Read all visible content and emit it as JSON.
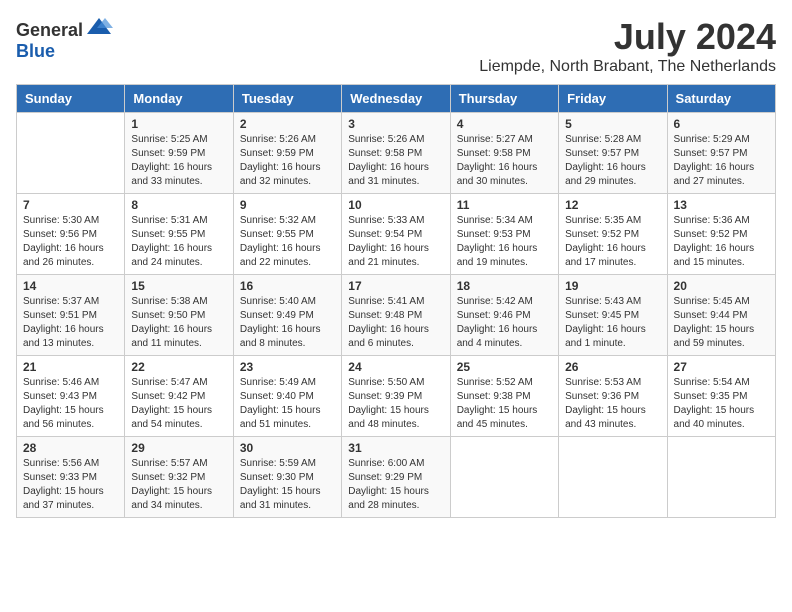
{
  "header": {
    "logo_general": "General",
    "logo_blue": "Blue",
    "month_year": "July 2024",
    "location": "Liempde, North Brabant, The Netherlands"
  },
  "days_of_week": [
    "Sunday",
    "Monday",
    "Tuesday",
    "Wednesday",
    "Thursday",
    "Friday",
    "Saturday"
  ],
  "weeks": [
    [
      {
        "day": "",
        "info": ""
      },
      {
        "day": "1",
        "info": "Sunrise: 5:25 AM\nSunset: 9:59 PM\nDaylight: 16 hours\nand 33 minutes."
      },
      {
        "day": "2",
        "info": "Sunrise: 5:26 AM\nSunset: 9:59 PM\nDaylight: 16 hours\nand 32 minutes."
      },
      {
        "day": "3",
        "info": "Sunrise: 5:26 AM\nSunset: 9:58 PM\nDaylight: 16 hours\nand 31 minutes."
      },
      {
        "day": "4",
        "info": "Sunrise: 5:27 AM\nSunset: 9:58 PM\nDaylight: 16 hours\nand 30 minutes."
      },
      {
        "day": "5",
        "info": "Sunrise: 5:28 AM\nSunset: 9:57 PM\nDaylight: 16 hours\nand 29 minutes."
      },
      {
        "day": "6",
        "info": "Sunrise: 5:29 AM\nSunset: 9:57 PM\nDaylight: 16 hours\nand 27 minutes."
      }
    ],
    [
      {
        "day": "7",
        "info": "Sunrise: 5:30 AM\nSunset: 9:56 PM\nDaylight: 16 hours\nand 26 minutes."
      },
      {
        "day": "8",
        "info": "Sunrise: 5:31 AM\nSunset: 9:55 PM\nDaylight: 16 hours\nand 24 minutes."
      },
      {
        "day": "9",
        "info": "Sunrise: 5:32 AM\nSunset: 9:55 PM\nDaylight: 16 hours\nand 22 minutes."
      },
      {
        "day": "10",
        "info": "Sunrise: 5:33 AM\nSunset: 9:54 PM\nDaylight: 16 hours\nand 21 minutes."
      },
      {
        "day": "11",
        "info": "Sunrise: 5:34 AM\nSunset: 9:53 PM\nDaylight: 16 hours\nand 19 minutes."
      },
      {
        "day": "12",
        "info": "Sunrise: 5:35 AM\nSunset: 9:52 PM\nDaylight: 16 hours\nand 17 minutes."
      },
      {
        "day": "13",
        "info": "Sunrise: 5:36 AM\nSunset: 9:52 PM\nDaylight: 16 hours\nand 15 minutes."
      }
    ],
    [
      {
        "day": "14",
        "info": "Sunrise: 5:37 AM\nSunset: 9:51 PM\nDaylight: 16 hours\nand 13 minutes."
      },
      {
        "day": "15",
        "info": "Sunrise: 5:38 AM\nSunset: 9:50 PM\nDaylight: 16 hours\nand 11 minutes."
      },
      {
        "day": "16",
        "info": "Sunrise: 5:40 AM\nSunset: 9:49 PM\nDaylight: 16 hours\nand 8 minutes."
      },
      {
        "day": "17",
        "info": "Sunrise: 5:41 AM\nSunset: 9:48 PM\nDaylight: 16 hours\nand 6 minutes."
      },
      {
        "day": "18",
        "info": "Sunrise: 5:42 AM\nSunset: 9:46 PM\nDaylight: 16 hours\nand 4 minutes."
      },
      {
        "day": "19",
        "info": "Sunrise: 5:43 AM\nSunset: 9:45 PM\nDaylight: 16 hours\nand 1 minute."
      },
      {
        "day": "20",
        "info": "Sunrise: 5:45 AM\nSunset: 9:44 PM\nDaylight: 15 hours\nand 59 minutes."
      }
    ],
    [
      {
        "day": "21",
        "info": "Sunrise: 5:46 AM\nSunset: 9:43 PM\nDaylight: 15 hours\nand 56 minutes."
      },
      {
        "day": "22",
        "info": "Sunrise: 5:47 AM\nSunset: 9:42 PM\nDaylight: 15 hours\nand 54 minutes."
      },
      {
        "day": "23",
        "info": "Sunrise: 5:49 AM\nSunset: 9:40 PM\nDaylight: 15 hours\nand 51 minutes."
      },
      {
        "day": "24",
        "info": "Sunrise: 5:50 AM\nSunset: 9:39 PM\nDaylight: 15 hours\nand 48 minutes."
      },
      {
        "day": "25",
        "info": "Sunrise: 5:52 AM\nSunset: 9:38 PM\nDaylight: 15 hours\nand 45 minutes."
      },
      {
        "day": "26",
        "info": "Sunrise: 5:53 AM\nSunset: 9:36 PM\nDaylight: 15 hours\nand 43 minutes."
      },
      {
        "day": "27",
        "info": "Sunrise: 5:54 AM\nSunset: 9:35 PM\nDaylight: 15 hours\nand 40 minutes."
      }
    ],
    [
      {
        "day": "28",
        "info": "Sunrise: 5:56 AM\nSunset: 9:33 PM\nDaylight: 15 hours\nand 37 minutes."
      },
      {
        "day": "29",
        "info": "Sunrise: 5:57 AM\nSunset: 9:32 PM\nDaylight: 15 hours\nand 34 minutes."
      },
      {
        "day": "30",
        "info": "Sunrise: 5:59 AM\nSunset: 9:30 PM\nDaylight: 15 hours\nand 31 minutes."
      },
      {
        "day": "31",
        "info": "Sunrise: 6:00 AM\nSunset: 9:29 PM\nDaylight: 15 hours\nand 28 minutes."
      },
      {
        "day": "",
        "info": ""
      },
      {
        "day": "",
        "info": ""
      },
      {
        "day": "",
        "info": ""
      }
    ]
  ]
}
